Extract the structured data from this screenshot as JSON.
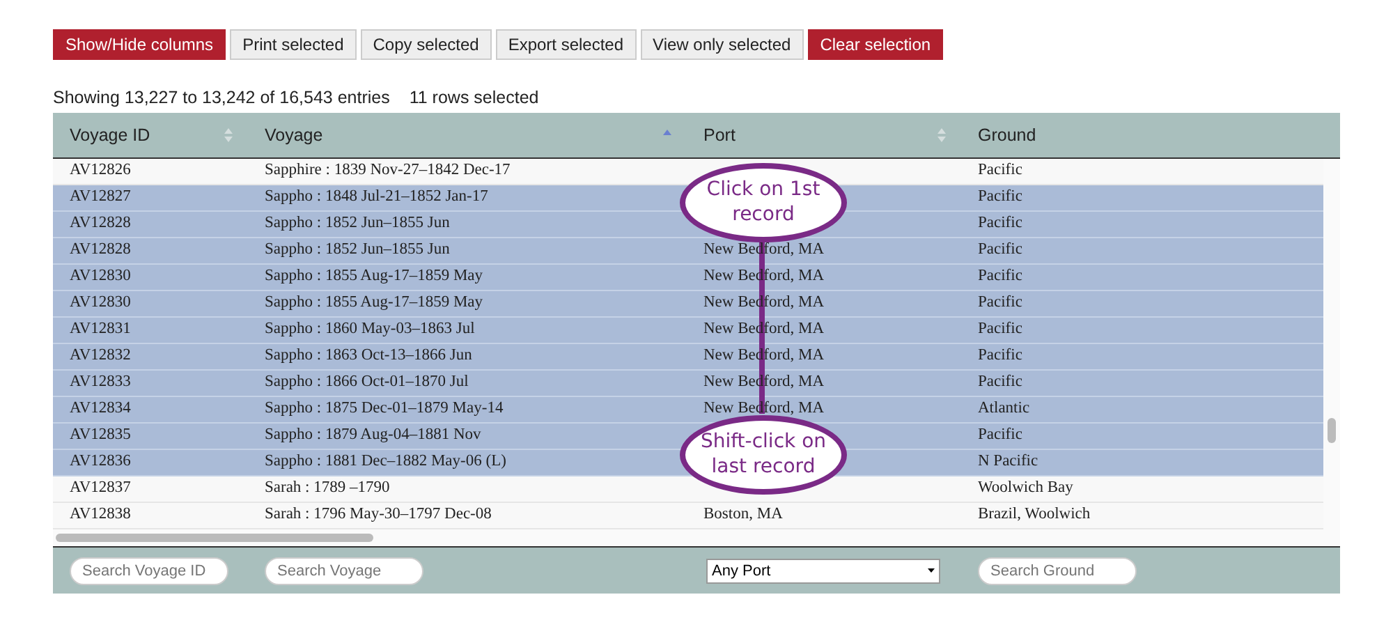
{
  "toolbar": [
    {
      "label": "Show/Hide columns",
      "kind": "primary"
    },
    {
      "label": "Print selected",
      "kind": "default"
    },
    {
      "label": "Copy selected",
      "kind": "default"
    },
    {
      "label": "Export selected",
      "kind": "default"
    },
    {
      "label": "View only selected",
      "kind": "default"
    },
    {
      "label": "Clear selection",
      "kind": "primary"
    }
  ],
  "info": {
    "entries": "Showing 13,227 to 13,242 of 16,543 entries",
    "selection": "11 rows selected"
  },
  "table": {
    "columns": [
      {
        "label": "Voyage ID",
        "kind": "sortable"
      },
      {
        "label": "Voyage",
        "kind": "sorted"
      },
      {
        "label": "Port",
        "kind": "sortable"
      },
      {
        "label": "Ground",
        "kind": "plain"
      }
    ],
    "rows": [
      {
        "cells": [
          "AV12826",
          "Sapphire : 1839 Nov-27–1842 Dec-17",
          "",
          "Pacific"
        ],
        "selected": false
      },
      {
        "cells": [
          "AV12827",
          "Sappho : 1848 Jul-21–1852 Jan-17",
          "",
          "Pacific"
        ],
        "selected": true
      },
      {
        "cells": [
          "AV12828",
          "Sappho : 1852 Jun–1855 Jun",
          "",
          "Pacific"
        ],
        "selected": true
      },
      {
        "cells": [
          "AV12828",
          "Sappho : 1852 Jun–1855 Jun",
          "New Bedford, MA",
          "Pacific"
        ],
        "selected": true
      },
      {
        "cells": [
          "AV12830",
          "Sappho : 1855 Aug-17–1859 May",
          "New Bedford, MA",
          "Pacific"
        ],
        "selected": true
      },
      {
        "cells": [
          "AV12830",
          "Sappho : 1855 Aug-17–1859 May",
          "New Bedford, MA",
          "Pacific"
        ],
        "selected": true
      },
      {
        "cells": [
          "AV12831",
          "Sappho : 1860 May-03–1863 Jul",
          "New Bedford, MA",
          "Pacific"
        ],
        "selected": true
      },
      {
        "cells": [
          "AV12832",
          "Sappho : 1863 Oct-13–1866 Jun",
          "New Bedford, MA",
          "Pacific"
        ],
        "selected": true
      },
      {
        "cells": [
          "AV12833",
          "Sappho : 1866 Oct-01–1870 Jul",
          "New Bedford, MA",
          "Pacific"
        ],
        "selected": true
      },
      {
        "cells": [
          "AV12834",
          "Sappho : 1875 Dec-01–1879 May-14",
          "New Bedford, MA",
          "Atlantic"
        ],
        "selected": true
      },
      {
        "cells": [
          "AV12835",
          "Sappho : 1879 Aug-04–1881 Nov",
          "",
          "Pacific"
        ],
        "selected": true
      },
      {
        "cells": [
          "AV12836",
          "Sappho : 1881 Dec–1882 May-06 (L)",
          "",
          "N Pacific"
        ],
        "selected": true
      },
      {
        "cells": [
          "AV12837",
          "Sarah : 1789 –1790",
          "",
          "Woolwich Bay"
        ],
        "selected": false
      },
      {
        "cells": [
          "AV12838",
          "Sarah : 1796 May-30–1797 Dec-08",
          "Boston, MA",
          "Brazil, Woolwich"
        ],
        "selected": false
      }
    ]
  },
  "filters": [
    {
      "kind": "search",
      "placeholder": "Search Voyage ID"
    },
    {
      "kind": "search",
      "placeholder": "Search Voyage"
    },
    {
      "kind": "select",
      "value": "Any Port"
    },
    {
      "kind": "search",
      "placeholder": "Search Ground"
    }
  ],
  "callouts": [
    {
      "text": "Click on 1st record"
    },
    {
      "text": "Shift-click on last record"
    }
  ]
}
